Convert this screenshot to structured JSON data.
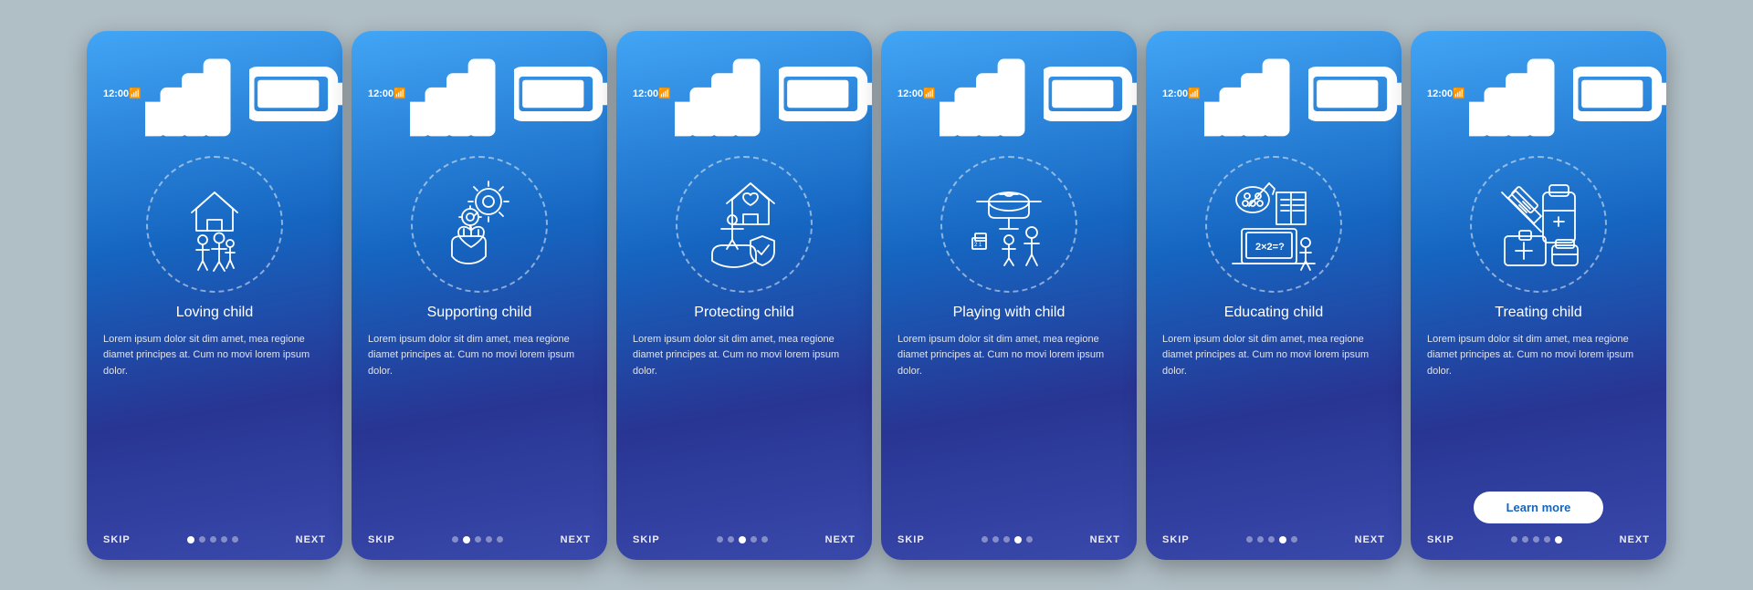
{
  "screens": [
    {
      "id": "loving",
      "title": "Loving child",
      "description": "Lorem ipsum dolor sit dim amet, mea regione diamet principes at. Cum no movi lorem ipsum dolor.",
      "active_dot": 0,
      "dots": [
        true,
        false,
        false,
        false,
        false
      ],
      "icon_name": "family-home-icon",
      "has_button": false
    },
    {
      "id": "supporting",
      "title": "Supporting child",
      "description": "Lorem ipsum dolor sit dim amet, mea regione diamet principes at. Cum no movi lorem ipsum dolor.",
      "active_dot": 1,
      "dots": [
        false,
        true,
        false,
        false,
        false
      ],
      "icon_name": "heart-gears-hand-icon",
      "has_button": false
    },
    {
      "id": "protecting",
      "title": "Protecting child",
      "description": "Lorem ipsum dolor sit dim amet, mea regione diamet principes at. Cum no movi lorem ipsum dolor.",
      "active_dot": 2,
      "dots": [
        false,
        false,
        true,
        false,
        false
      ],
      "icon_name": "child-shield-house-icon",
      "has_button": false
    },
    {
      "id": "playing",
      "title": "Playing with child",
      "description": "Lorem ipsum dolor sit dim amet, mea regione diamet principes at. Cum no movi lorem ipsum dolor.",
      "active_dot": 3,
      "dots": [
        false,
        false,
        false,
        true,
        false
      ],
      "icon_name": "helicopter-play-icon",
      "has_button": false
    },
    {
      "id": "educating",
      "title": "Educating child",
      "description": "Lorem ipsum dolor sit dim amet, mea regione diamet principes at. Cum no movi lorem ipsum dolor.",
      "active_dot": 3,
      "dots": [
        false,
        false,
        false,
        true,
        false
      ],
      "icon_name": "education-icon",
      "has_button": false
    },
    {
      "id": "treating",
      "title": "Treating child",
      "description": "Lorem ipsum dolor sit dim amet, mea regione diamet principes at. Cum no movi lorem ipsum dolor.",
      "active_dot": 4,
      "dots": [
        false,
        false,
        false,
        false,
        true
      ],
      "icon_name": "medicine-icon",
      "has_button": true,
      "button_label": "Learn more"
    }
  ],
  "nav": {
    "skip": "SKIP",
    "next": "NEXT"
  },
  "status": {
    "time": "12:00"
  }
}
